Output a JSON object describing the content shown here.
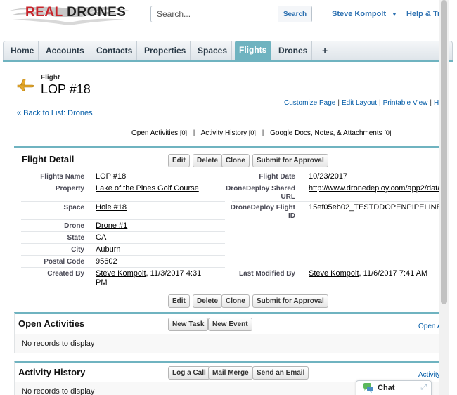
{
  "brand": {
    "real": "REAL",
    "drones": "DRONES",
    "accent": "#c8242b"
  },
  "search": {
    "placeholder": "Search...",
    "button": "Search"
  },
  "user": {
    "name": "Steve Kompolt",
    "caret": "▼"
  },
  "help_link": "Help & Tr",
  "tabs": [
    {
      "label": "Home"
    },
    {
      "label": "Accounts"
    },
    {
      "label": "Contacts"
    },
    {
      "label": "Properties"
    },
    {
      "label": "Spaces"
    },
    {
      "label": "Flights",
      "active": true
    },
    {
      "label": "Drones"
    },
    {
      "label": "+"
    }
  ],
  "colors": {
    "tab_active": "#6fb3c0",
    "link": "#015ba7"
  },
  "record": {
    "type": "Flight",
    "title": "LOP #18"
  },
  "page_links": [
    "Customize Page",
    "Edit Layout",
    "Printable View",
    "He"
  ],
  "back_link": "« Back to List: Drones",
  "related_links": [
    {
      "label": "Open Activities",
      "count": "[0]"
    },
    {
      "label": "Activity History",
      "count": "[0]"
    },
    {
      "label": "Google Docs, Notes, & Attachments",
      "count": "[0]"
    }
  ],
  "detail": {
    "title": "Flight Detail",
    "buttons": [
      "Edit",
      "Delete",
      "Clone",
      "Submit for Approval"
    ],
    "left_fields": [
      {
        "label": "Flights Name",
        "value": "LOP #18"
      },
      {
        "label": "Property",
        "value": "Lake of the Pines Golf Course"
      },
      {
        "label": "Space",
        "value": "Hole #18"
      },
      {
        "label": "Drone",
        "value": "Drone #1"
      },
      {
        "label": "State",
        "value": "CA"
      },
      {
        "label": "City",
        "value": "Auburn"
      },
      {
        "label": "Postal Code",
        "value": "95602"
      },
      {
        "label": "Created By",
        "value": "Steve Kompolt",
        "value2": ", 11/3/2017 4:31",
        "value3": "PM"
      }
    ],
    "right_fields": [
      {
        "label": "Flight Date",
        "value": "10/23/2017"
      },
      {
        "label": "DroneDeploy Shared",
        "label2": "URL",
        "value": "http://www.dronedeploy.com/app2/data"
      },
      {
        "label": "DroneDeploy Flight",
        "label2": "ID",
        "value": "15ef05eb02_TESTDDOPENPIPELINE"
      },
      {
        "label": "Last Modified By",
        "value": "Steve Kompolt",
        "value2": ", 11/6/2017 7:41 AM"
      }
    ]
  },
  "open_activities": {
    "title": "Open Activities",
    "buttons": [
      "New Task",
      "New Event"
    ],
    "right_link": "Open A",
    "empty": "No records to display"
  },
  "activity_history": {
    "title": "Activity History",
    "buttons": [
      "Log a Call",
      "Mail Merge",
      "Send an Email"
    ],
    "right_link": "Activity",
    "empty": "No records to display"
  },
  "chat": {
    "label": "Chat"
  }
}
